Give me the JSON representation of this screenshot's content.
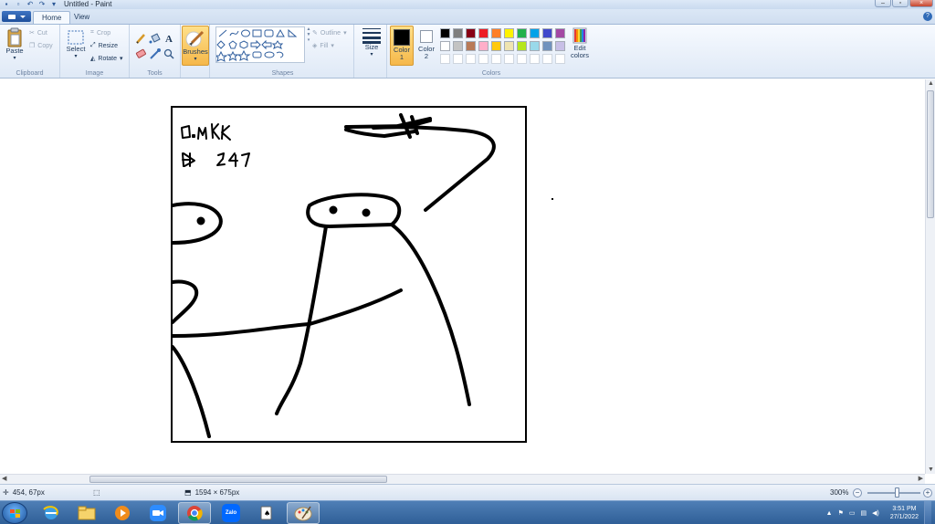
{
  "window": {
    "title": "Untitled - Paint"
  },
  "tabs": [
    {
      "label": "Home",
      "active": true
    },
    {
      "label": "View",
      "active": false
    }
  ],
  "ribbon": {
    "clipboard": {
      "paste": "Paste",
      "cut": "Cut",
      "copy": "Copy",
      "label": "Clipboard"
    },
    "image": {
      "select": "Select",
      "crop": "Crop",
      "resize": "Resize",
      "rotate": "Rotate",
      "label": "Image"
    },
    "tools": {
      "label": "Tools",
      "items": [
        "pencil-icon",
        "fill-icon",
        "text-icon",
        "eraser-icon",
        "color-picker-icon",
        "magnifier-icon"
      ]
    },
    "brushes": {
      "label": "Brushes"
    },
    "shapes": {
      "label": "Shapes",
      "outline": "Outline",
      "fill": "Fill"
    },
    "size": {
      "label": "Size"
    },
    "colors": {
      "label": "Colors",
      "color1": "Color\n1",
      "color1_a": "Color",
      "color1_b": "1",
      "color2_a": "Color",
      "color2_b": "2",
      "edit_a": "Edit",
      "edit_b": "colors",
      "color1_value": "#000000",
      "color2_value": "#ffffff",
      "palette_row1": [
        "#000000",
        "#7f7f7f",
        "#880015",
        "#ed1c24",
        "#ff7f27",
        "#fff200",
        "#22b14c",
        "#00a2e8",
        "#3f48cc",
        "#a349a4"
      ],
      "palette_row2": [
        "#ffffff",
        "#c3c3c3",
        "#b97a57",
        "#ffaec9",
        "#ffc90e",
        "#efe4b0",
        "#b5e61d",
        "#99d9ea",
        "#7092be",
        "#c8bfe7"
      ],
      "palette_row3": [
        "#ffffff",
        "#ffffff",
        "#ffffff",
        "#ffffff",
        "#ffffff",
        "#ffffff",
        "#ffffff",
        "#ffffff",
        "#ffffff",
        "#ffffff"
      ]
    }
  },
  "status": {
    "cursor": "454, 67px",
    "canvas_size": "1594 × 675px",
    "zoom": "300%"
  },
  "taskbar": {
    "apps": [
      "internet-explorer-icon",
      "file-explorer-icon",
      "media-player-icon",
      "zoom-icon",
      "chrome-icon",
      "zalo-icon",
      "solitaire-icon",
      "paint-icon"
    ],
    "zalo_text": "Zalo",
    "time": "3:51 PM",
    "date": "27/1/2022"
  },
  "colors": {
    "ribbon_bg": "#dfe9f6",
    "taskbar": "#2f5f97",
    "accent": "#2f6ab7"
  }
}
